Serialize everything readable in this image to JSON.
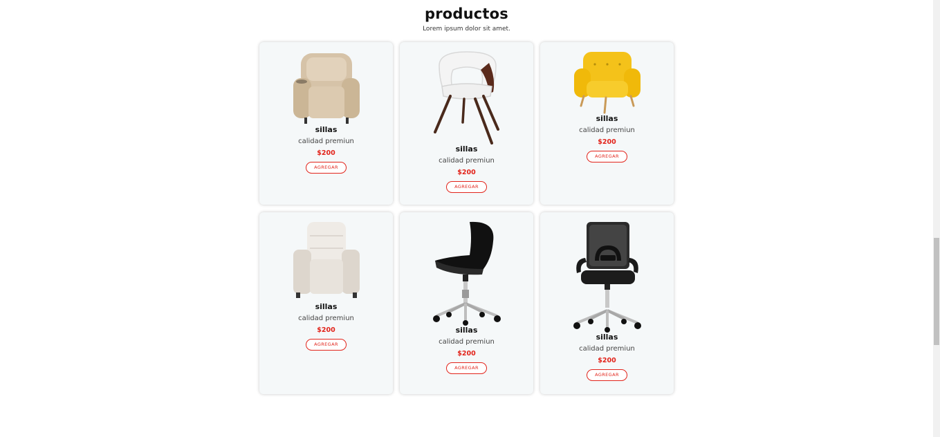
{
  "section": {
    "title": "productos",
    "subtitle": "Lorem ipsum dolor sit amet."
  },
  "products": [
    {
      "name": "sillas",
      "description": "calidad premiun",
      "price": "$200",
      "button_label": "AGREGAR",
      "icon": "kids-recliner-beige"
    },
    {
      "name": "sillas",
      "description": "calidad premiun",
      "price": "$200",
      "button_label": "AGREGAR",
      "icon": "white-wood-chair"
    },
    {
      "name": "sillas",
      "description": "calidad premiun",
      "price": "$200",
      "button_label": "AGREGAR",
      "icon": "yellow-armchair"
    },
    {
      "name": "sillas",
      "description": "calidad premiun",
      "price": "$200",
      "button_label": "AGREGAR",
      "icon": "cream-recliner"
    },
    {
      "name": "sillas",
      "description": "calidad premiun",
      "price": "$200",
      "button_label": "AGREGAR",
      "icon": "black-swivel-chair"
    },
    {
      "name": "sillas",
      "description": "calidad premiun",
      "price": "$200",
      "button_label": "AGREGAR",
      "icon": "mesh-office-chair"
    }
  ],
  "colors": {
    "accent": "#e2231a",
    "card_background": "#f5f8f9"
  }
}
